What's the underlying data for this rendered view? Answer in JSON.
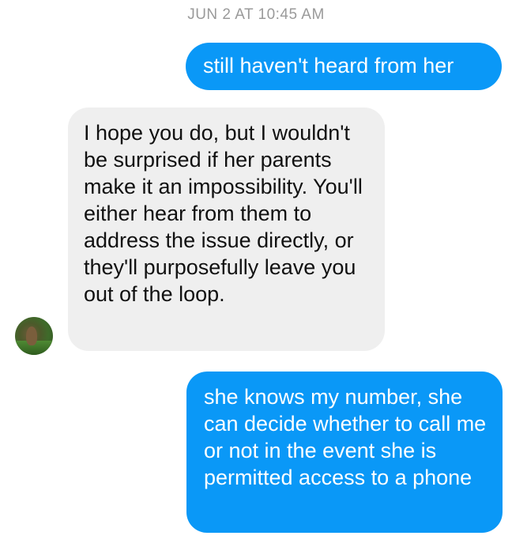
{
  "conversation": {
    "timestamp": "JUN 2 AT 10:45 AM",
    "messages": [
      {
        "direction": "sent",
        "text": "still haven't heard from her"
      },
      {
        "direction": "received",
        "text": "I hope you do, but I wouldn't be surprised if her parents make it an impossibility. You'll either hear from them to address the issue directly, or they'll purposefully leave you out of the loop."
      },
      {
        "direction": "sent",
        "text": "she knows my number, she can decide whether to call me or not in the event she is permitted access to a phone"
      }
    ]
  },
  "colors": {
    "sent_bubble": "#0a98f7",
    "received_bubble": "#efefef",
    "timestamp_text": "#9a9a9a"
  },
  "icons": {
    "contact_avatar": "avatar"
  }
}
